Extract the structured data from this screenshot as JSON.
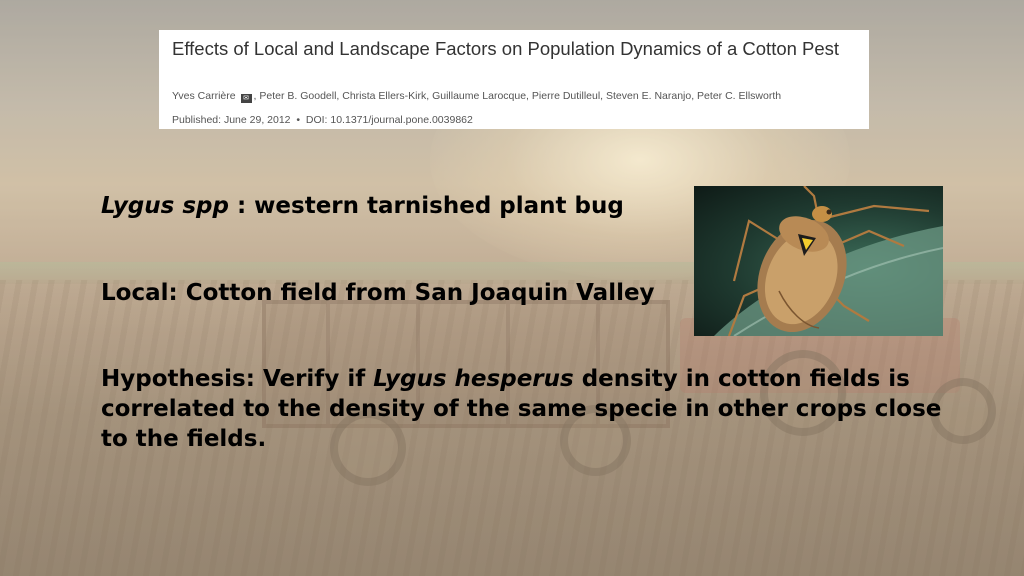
{
  "paper": {
    "title": "Effects of Local and Landscape Factors on Population Dynamics of a Cotton Pest",
    "authors_first": "Yves Carrière",
    "authors_rest": ", Peter B. Goodell, Christa Ellers-Kirk, Guillaume Larocque, Pierre Dutilleul, Steven E. Naranjo, Peter C. Ellsworth",
    "published": "Published: June 29, 2012",
    "doi": "DOI: 10.1371/journal.pone.0039862"
  },
  "slide": {
    "line1_italic": "Lygus spp",
    "line1_rest": " : western tarnished plant bug",
    "line2": "Local: Cotton field from San Joaquin Valley",
    "line3_a": "Hypothesis: Verify if ",
    "line3_italic": "Lygus hesperus",
    "line3_b": " density in cotton fields is correlated to the density of the same specie in other crops close to the fields."
  },
  "colors": {
    "title_text": "#333333",
    "meta_text": "#555555",
    "body_text": "#000000"
  },
  "icons": {
    "mail": "envelope-icon",
    "bug": "lygus-bug-photo"
  }
}
